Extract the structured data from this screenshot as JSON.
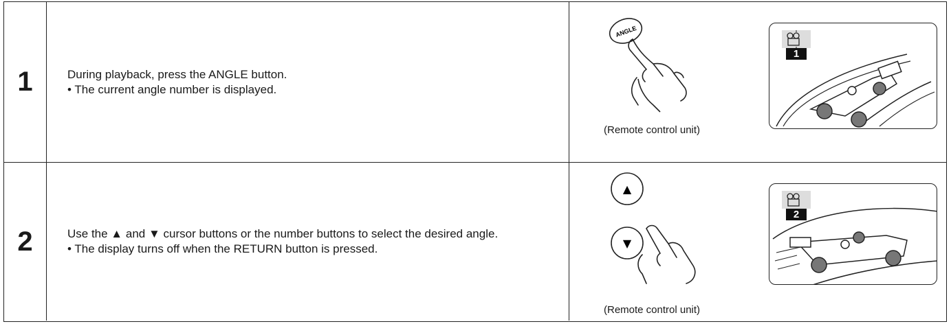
{
  "steps": [
    {
      "number": "1",
      "line1": "During playback, press the ANGLE button.",
      "bullet": "•  The current angle number is displayed.",
      "caption": "(Remote control unit)",
      "button_label": "ANGLE",
      "angle_display": "1"
    },
    {
      "number": "2",
      "line1": "Use the ▲ and ▼ cursor buttons or the number buttons to select the desired angle.",
      "bullet": "•  The display turns off when the RETURN button is pressed.",
      "caption": "(Remote control unit)",
      "up_label": "▲",
      "down_label": "▼",
      "angle_display": "2"
    }
  ]
}
